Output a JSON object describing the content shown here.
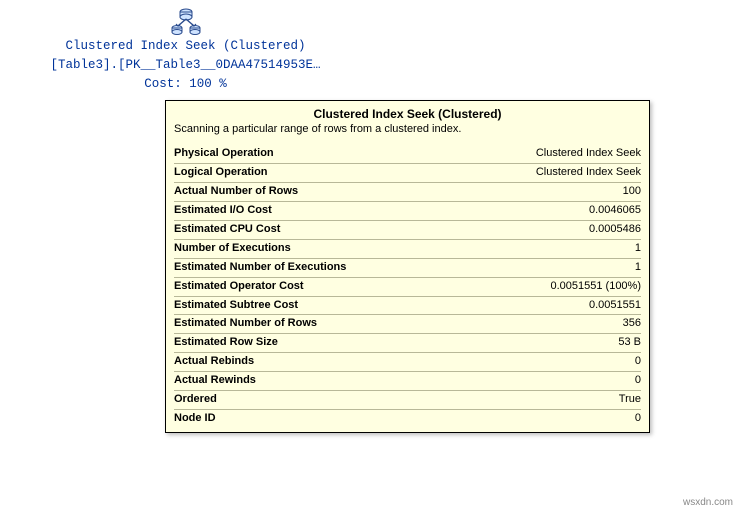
{
  "plan_node": {
    "line1": "Clustered Index Seek (Clustered)",
    "line2": "[Table3].[PK__Table3__0DAA47514953E…",
    "line3": "Cost: 100 %"
  },
  "tooltip": {
    "title": "Clustered Index Seek (Clustered)",
    "description": "Scanning a particular range of rows from a clustered index.",
    "rows": [
      {
        "label": "Physical Operation",
        "value": "Clustered Index Seek"
      },
      {
        "label": "Logical Operation",
        "value": "Clustered Index Seek"
      },
      {
        "label": "Actual Number of Rows",
        "value": "100"
      },
      {
        "label": "Estimated I/O Cost",
        "value": "0.0046065"
      },
      {
        "label": "Estimated CPU Cost",
        "value": "0.0005486"
      },
      {
        "label": "Number of Executions",
        "value": "1"
      },
      {
        "label": "Estimated Number of Executions",
        "value": "1"
      },
      {
        "label": "Estimated Operator Cost",
        "value": "0.0051551 (100%)"
      },
      {
        "label": "Estimated Subtree Cost",
        "value": "0.0051551"
      },
      {
        "label": "Estimated Number of Rows",
        "value": "356"
      },
      {
        "label": "Estimated Row Size",
        "value": "53 B"
      },
      {
        "label": "Actual Rebinds",
        "value": "0"
      },
      {
        "label": "Actual Rewinds",
        "value": "0"
      },
      {
        "label": "Ordered",
        "value": "True"
      },
      {
        "label": "Node ID",
        "value": "0"
      }
    ]
  },
  "watermark": "wsxdn.com"
}
